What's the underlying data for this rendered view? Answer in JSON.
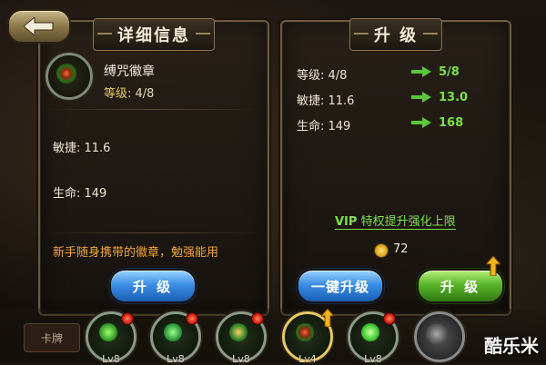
{
  "left_panel": {
    "title": "详细信息",
    "item_name": "缚咒徽章",
    "level_label": "等级:",
    "level_value": "4/8",
    "stats": [
      "敏捷: 11.6",
      "生命: 149"
    ],
    "description": "新手随身携带的徽章，勉强能用",
    "upgrade_button": "升 级"
  },
  "right_panel": {
    "title": "升 级",
    "rows": [
      {
        "label": "等级: 4/8",
        "new": "5/8"
      },
      {
        "label": "敏捷: 11.6",
        "new": "13.0"
      },
      {
        "label": "生命: 149",
        "new": "168"
      }
    ],
    "vip_prefix": "VIP",
    "vip_text": "特权提升强化上限",
    "coins": "72",
    "one_click_button": "一键升级",
    "upgrade_button": "升 级"
  },
  "bottom_bar": {
    "slots": [
      {
        "level": "Lv8",
        "has_dot": true,
        "gem_color": "#3aa02a"
      },
      {
        "level": "Lv8",
        "has_dot": true,
        "gem_color": "#2f9a3a"
      },
      {
        "level": "Lv8",
        "has_dot": true,
        "gem_color": "#3c8a2a"
      },
      {
        "level": "Lv4",
        "has_arrow": true,
        "gem_color": "#c83a1a"
      },
      {
        "level": "Lv8",
        "has_dot": true,
        "gem_color": "#4ad03a"
      }
    ],
    "side_tab": "卡牌"
  },
  "watermark": "酷乐米",
  "colors": {
    "accent_green": "#7ee04a",
    "accent_orange": "#f0a63a",
    "gold": "#e8c860"
  }
}
